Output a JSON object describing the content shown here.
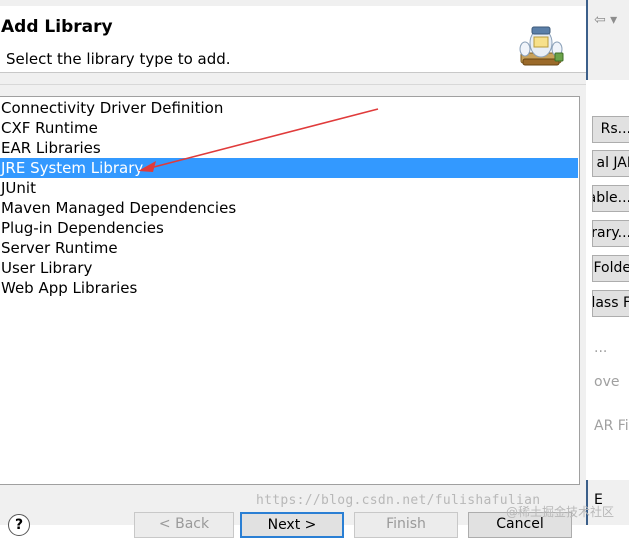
{
  "dialog": {
    "title": "Add Library",
    "description": "Select the library type to add."
  },
  "library_types": [
    {
      "label": "Connectivity Driver Definition",
      "selected": false
    },
    {
      "label": "CXF Runtime",
      "selected": false
    },
    {
      "label": "EAR Libraries",
      "selected": false
    },
    {
      "label": "JRE System Library",
      "selected": true
    },
    {
      "label": "JUnit",
      "selected": false
    },
    {
      "label": "Maven Managed Dependencies",
      "selected": false
    },
    {
      "label": "Plug-in Dependencies",
      "selected": false
    },
    {
      "label": "Server Runtime",
      "selected": false
    },
    {
      "label": "User Library",
      "selected": false
    },
    {
      "label": "Web App Libraries",
      "selected": false
    }
  ],
  "footer": {
    "help": "?",
    "back": "< Back",
    "next": "Next >",
    "finish": "Finish",
    "cancel": "Cancel"
  },
  "right_panel": {
    "nav": "⇦ ▾",
    "buttons": [
      "Rs...",
      "al JAI",
      "able...",
      "rary...",
      "Folde",
      "lass F"
    ],
    "disabled": [
      "...",
      "ove",
      "AR Fil"
    ],
    "bottom_label": "E"
  },
  "watermark": {
    "url": "https://blog.csdn.net/fulishafulian",
    "site": "@稀土掘金技术社区"
  },
  "colors": {
    "selection": "#3399ff",
    "annotation_arrow": "#e03b3b"
  }
}
